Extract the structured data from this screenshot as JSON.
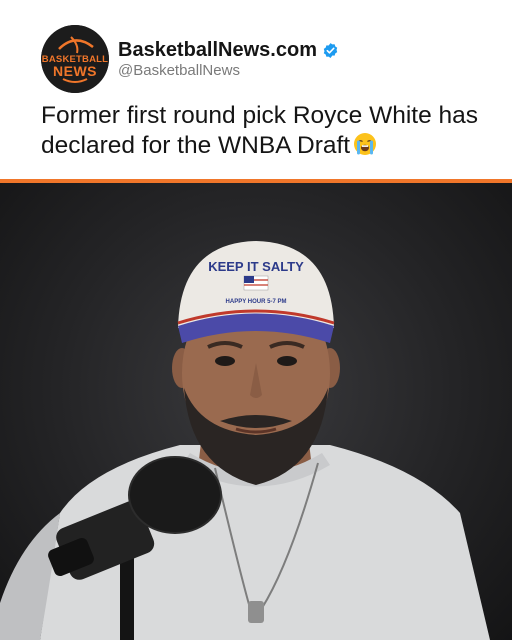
{
  "post": {
    "account_name": "BasketballNews.com",
    "handle": "@BasketballNews",
    "verified": true,
    "headline": "Former first round pick Royce White has declared for the WNBA Draft",
    "headline_emoji": "loudly-crying-face",
    "avatar": {
      "line1": "BASKETBALL",
      "line2": "NEWS"
    }
  },
  "media": {
    "hat_text": "KEEP IT SALTY",
    "hat_subtext": "HAPPY HOUR 5-7 PM"
  },
  "colors": {
    "accent": "#f0762a",
    "verified_blue": "#1d9bf0",
    "text": "#151515",
    "handle": "#7a7a7a"
  }
}
